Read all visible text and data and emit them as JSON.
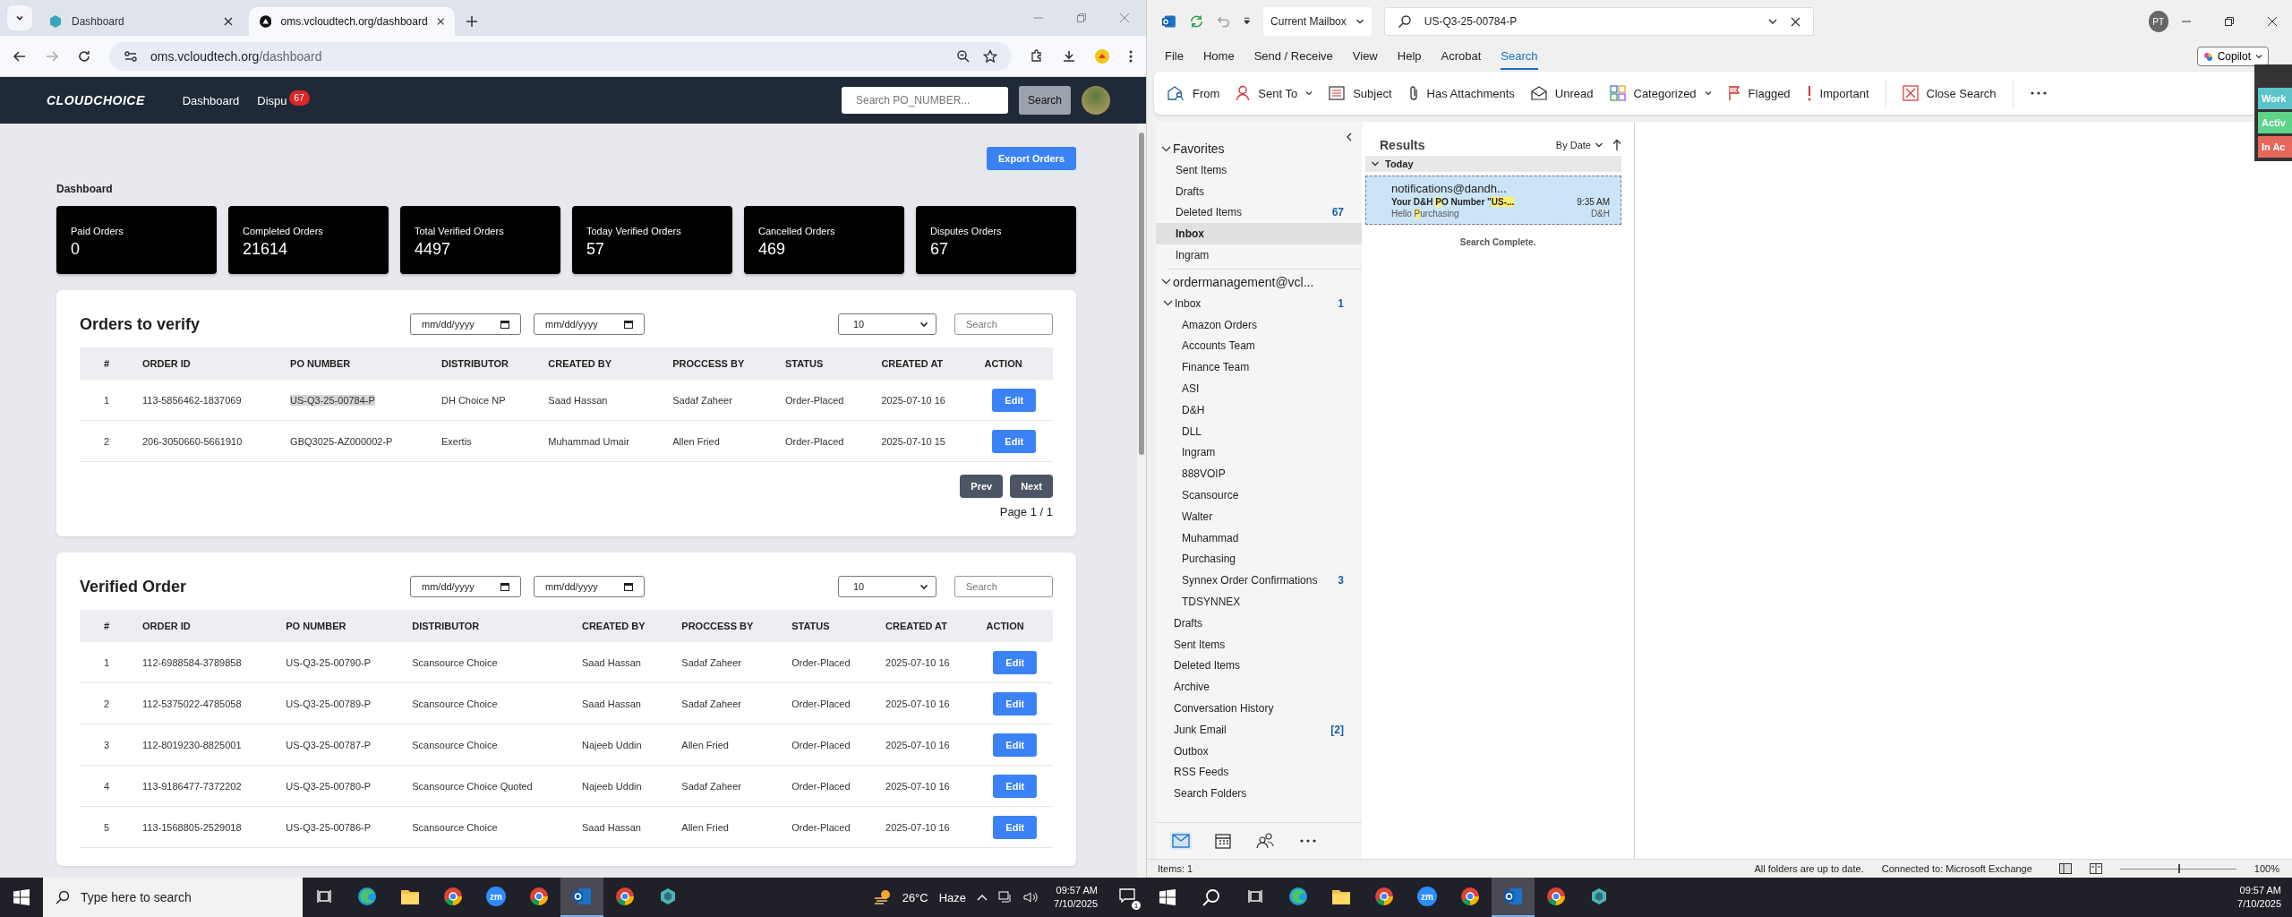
{
  "browser": {
    "tabs": [
      {
        "title": "Dashboard",
        "selected": false
      },
      {
        "title": "oms.vcloudtech.org/dashboard",
        "selected": true
      }
    ],
    "address": {
      "host": "oms.vcloudtech.org",
      "path": "/dashboard"
    }
  },
  "app": {
    "brand": "CLOUDCHOICE",
    "nav": [
      {
        "label": "Dashboard"
      },
      {
        "label": "Dispu",
        "badge": "67"
      }
    ],
    "search": {
      "placeholder": "Search PO_NUMBER...",
      "button": "Search"
    },
    "export_button": "Export Orders",
    "heading": "Dashboard",
    "stats": [
      {
        "label": "Paid Orders",
        "value": "0"
      },
      {
        "label": "Completed Orders",
        "value": "21614"
      },
      {
        "label": "Total Verified Orders",
        "value": "4497"
      },
      {
        "label": "Today Verified Orders",
        "value": "57"
      },
      {
        "label": "Cancelled Orders",
        "value": "469"
      },
      {
        "label": "Disputes Orders",
        "value": "67"
      }
    ],
    "tables": [
      {
        "title": "Orders to verify",
        "date_filters": [
          "mm/dd/yyyy",
          "mm/dd/yyyy"
        ],
        "page_size": "10",
        "search_placeholder": "Search",
        "columns": [
          "#",
          "ORDER ID",
          "PO NUMBER",
          "DISTRIBUTOR",
          "CREATED BY",
          "PROCCESS BY",
          "STATUS",
          "CREATED AT",
          "ACTION"
        ],
        "rows": [
          {
            "cells": [
              "1",
              "113-5856462-1837069",
              "US-Q3-25-00784-P",
              "DH Choice NP",
              "Saad Hassan",
              "Sadaf Zaheer",
              "Order-Placed",
              "2025-07-10 16"
            ],
            "action": "Edit",
            "po_selected": true
          },
          {
            "cells": [
              "2",
              "206-3050660-5661910",
              "GBQ3025-AZ000002-P",
              "Exertis",
              "Muhammad Umair",
              "Allen Fried",
              "Order-Placed",
              "2025-07-10 15"
            ],
            "action": "Edit",
            "po_selected": false
          }
        ],
        "pagination": {
          "prev": "Prev",
          "next": "Next",
          "page": "Page 1 / 1"
        }
      },
      {
        "title": "Verified Order",
        "date_filters": [
          "mm/dd/yyyy",
          "mm/dd/yyyy"
        ],
        "page_size": "10",
        "search_placeholder": "Search",
        "columns": [
          "#",
          "ORDER ID",
          "PO NUMBER",
          "DISTRIBUTOR",
          "CREATED BY",
          "PROCCESS BY",
          "STATUS",
          "CREATED AT",
          "ACTION"
        ],
        "rows": [
          {
            "cells": [
              "1",
              "112-6988584-3789858",
              "US-Q3-25-00790-P",
              "Scansource Choice",
              "Saad Hassan",
              "Sadaf Zaheer",
              "Order-Placed",
              "2025-07-10 16"
            ],
            "action": "Edit",
            "po_selected": false
          },
          {
            "cells": [
              "2",
              "112-5375022-4785058",
              "US-Q3-25-00789-P",
              "Scansource Choice",
              "Saad Hassan",
              "Sadaf Zaheer",
              "Order-Placed",
              "2025-07-10 16"
            ],
            "action": "Edit",
            "po_selected": false
          },
          {
            "cells": [
              "3",
              "112-8019230-8825001",
              "US-Q3-25-00787-P",
              "Scansource Choice",
              "Najeeb Uddin",
              "Allen Fried",
              "Order-Placed",
              "2025-07-10 16"
            ],
            "action": "Edit",
            "po_selected": false
          },
          {
            "cells": [
              "4",
              "113-9186477-7372202",
              "US-Q3-25-00780-P",
              "Scansource Choice Quoted",
              "Najeeb Uddin",
              "Sadaf Zaheer",
              "Order-Placed",
              "2025-07-10 16"
            ],
            "action": "Edit",
            "po_selected": false
          },
          {
            "cells": [
              "5",
              "113-1568805-2529018",
              "US-Q3-25-00786-P",
              "Scansource Choice",
              "Saad Hassan",
              "Allen Fried",
              "Order-Placed",
              "2025-07-10 16"
            ],
            "action": "Edit",
            "po_selected": false
          }
        ]
      }
    ]
  },
  "outlook": {
    "scope": "Current Mailbox",
    "search_value": "US-Q3-25-00784-P",
    "avatar": "PT",
    "menu": [
      {
        "label": "File",
        "selected": false
      },
      {
        "label": "Home",
        "selected": false
      },
      {
        "label": "Send / Receive",
        "selected": false
      },
      {
        "label": "View",
        "selected": false
      },
      {
        "label": "Help",
        "selected": false
      },
      {
        "label": "Acrobat",
        "selected": false
      },
      {
        "label": "Search",
        "selected": true
      }
    ],
    "copilot": "Copilot",
    "ribbon": [
      {
        "kind": "from",
        "label": "From",
        "dropdown": false
      },
      {
        "kind": "sentto",
        "label": "Sent To",
        "dropdown": true
      },
      {
        "kind": "subject",
        "label": "Subject",
        "dropdown": false
      },
      {
        "kind": "attachments",
        "label": "Has Attachments",
        "dropdown": false
      },
      {
        "kind": "unread",
        "label": "Unread",
        "dropdown": false
      },
      {
        "kind": "categorized",
        "label": "Categorized",
        "dropdown": true
      },
      {
        "kind": "flagged",
        "label": "Flagged",
        "dropdown": false
      },
      {
        "kind": "important",
        "label": "Important",
        "dropdown": false
      },
      {
        "kind": "close",
        "label": "Close Search",
        "dropdown": false
      }
    ],
    "side_tags": [
      {
        "label": "Work",
        "color": "#5ec4cc"
      },
      {
        "label": "Activ",
        "color": "#5dd38a"
      },
      {
        "label": "In Ac",
        "color": "#e8675b"
      }
    ],
    "favorites": {
      "label": "Favorites",
      "expanded": true,
      "items": [
        {
          "label": "Sent Items",
          "selected": false
        },
        {
          "label": "Drafts",
          "selected": false
        },
        {
          "label": "Deleted Items",
          "count": "67",
          "selected": false
        },
        {
          "label": "Inbox",
          "selected": true
        },
        {
          "label": "Ingram",
          "selected": false
        }
      ]
    },
    "account": {
      "label": "ordermanagement@vcl...",
      "expanded": true,
      "children": [
        {
          "label": "Inbox",
          "count": "1",
          "selected": false,
          "expanded": true,
          "children": [
            {
              "label": "Amazon Orders",
              "selected": false
            },
            {
              "label": "Accounts Team",
              "selected": false
            },
            {
              "label": "Finance Team",
              "selected": false
            },
            {
              "label": "ASI",
              "selected": false
            },
            {
              "label": "D&H",
              "selected": false
            },
            {
              "label": "DLL",
              "selected": false
            },
            {
              "label": "Ingram",
              "selected": false
            },
            {
              "label": "888VOIP",
              "selected": false
            },
            {
              "label": "Scansource",
              "selected": false
            },
            {
              "label": "Walter",
              "selected": false
            },
            {
              "label": "Muhammad",
              "selected": false
            },
            {
              "label": "Purchasing",
              "selected": false
            },
            {
              "label": "Synnex Order Confirmations",
              "count": "3",
              "selected": false
            },
            {
              "label": "TDSYNNEX",
              "selected": false
            }
          ]
        },
        {
          "label": "Drafts",
          "selected": false
        },
        {
          "label": "Sent Items",
          "selected": false
        },
        {
          "label": "Deleted Items",
          "selected": false
        },
        {
          "label": "Archive",
          "selected": false
        },
        {
          "label": "Conversation History",
          "selected": false
        },
        {
          "label": "Junk Email",
          "count": "[2]",
          "selected": false
        },
        {
          "label": "Outbox",
          "selected": false
        },
        {
          "label": "RSS Feeds",
          "selected": false
        },
        {
          "label": "Search Folders",
          "selected": false
        }
      ]
    },
    "modules": [
      {
        "kind": "mail",
        "selected": true
      },
      {
        "kind": "calendar",
        "selected": false
      },
      {
        "kind": "people",
        "selected": false
      },
      {
        "kind": "more",
        "selected": false
      }
    ],
    "results": {
      "title": "Results",
      "sort": "By Date",
      "group": {
        "label": "Today",
        "expanded": true
      },
      "messages": [
        {
          "sender": "notifications@dandh...",
          "subject": [
            {
              "text": "Your D&H ",
              "match": false
            },
            {
              "text": "P",
              "match": true
            },
            {
              "text": "O Number \"",
              "match": false
            },
            {
              "text": "US-...",
              "match": true
            }
          ],
          "time": "9:35 AM",
          "preview": [
            {
              "text": "Hello ",
              "match": false
            },
            {
              "text": "P",
              "match": true
            },
            {
              "text": "urchasing",
              "match": false
            }
          ],
          "category": "D&H",
          "selected": true
        }
      ],
      "footer": "Search Complete."
    },
    "status": {
      "items": "Items: 1",
      "sync": "All folders are up to date.",
      "connection": "Connected to: Microsoft Exchange",
      "zoom": "100%",
      "zoom_slider": {
        "level": 0.5
      }
    }
  },
  "taskbars": [
    {
      "search_placeholder": "Type here to search",
      "apps": [
        {
          "kind": "taskview",
          "active": false
        },
        {
          "kind": "edge",
          "active": false
        },
        {
          "kind": "files",
          "active": false
        },
        {
          "kind": "chrome",
          "active": false
        },
        {
          "kind": "zoom",
          "label": "zm",
          "active": false
        },
        {
          "kind": "chrome",
          "active": false
        },
        {
          "kind": "outlook",
          "active": true
        },
        {
          "kind": "chrome",
          "active": false
        },
        {
          "kind": "hex",
          "active": false
        }
      ],
      "weather": {
        "temp": "26°C",
        "condition": "Haze"
      },
      "time": "09:57 AM",
      "date": "7/10/2025",
      "notifications": "1"
    },
    {
      "apps": [
        {
          "kind": "taskview",
          "active": false
        },
        {
          "kind": "edge",
          "active": false
        },
        {
          "kind": "files",
          "active": false
        },
        {
          "kind": "chrome",
          "active": false
        },
        {
          "kind": "zoom",
          "label": "zm",
          "active": false
        },
        {
          "kind": "chrome",
          "active": false
        },
        {
          "kind": "outlook",
          "active": true
        },
        {
          "kind": "chrome",
          "active": false
        },
        {
          "kind": "hex",
          "active": false
        }
      ],
      "time": "09:57 AM",
      "date": "7/10/2025"
    }
  ]
}
